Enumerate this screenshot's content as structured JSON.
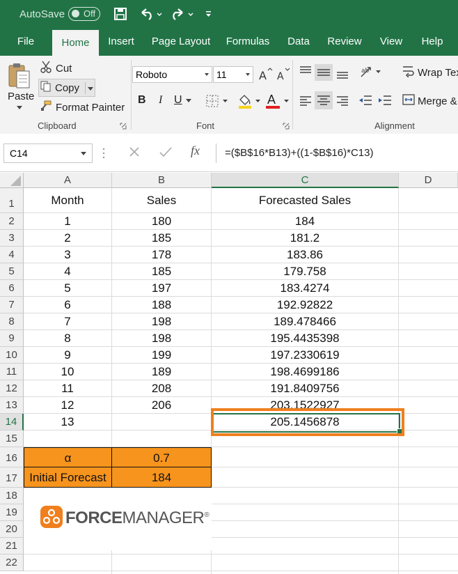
{
  "titlebar": {
    "autosave_label": "AutoSave",
    "autosave_state": "Off"
  },
  "tabs": [
    "File",
    "Home",
    "Insert",
    "Page Layout",
    "Formulas",
    "Data",
    "Review",
    "View",
    "Help"
  ],
  "clipboard": {
    "paste": "Paste",
    "cut": "Cut",
    "copy": "Copy",
    "format_painter": "Format Painter",
    "group_label": "Clipboard"
  },
  "font": {
    "family": "Roboto",
    "size": "11",
    "bold": "B",
    "italic": "I",
    "underline": "U",
    "color_letter": "A",
    "group_label": "Font"
  },
  "alignment": {
    "wrap_text": "Wrap Tex",
    "merge": "Merge &",
    "group_label": "Alignment"
  },
  "formula_bar": {
    "name_box": "C14",
    "formula": "=($B$16*B13)+((1-$B$16)*C13)",
    "fx": "fx"
  },
  "columns": [
    "A",
    "B",
    "C",
    "D"
  ],
  "rows": [
    "1",
    "2",
    "3",
    "4",
    "5",
    "6",
    "7",
    "8",
    "9",
    "10",
    "11",
    "12",
    "13",
    "14",
    "15",
    "16",
    "17",
    "18",
    "19",
    "20",
    "21",
    "22"
  ],
  "table": {
    "headers": [
      "Month",
      "Sales",
      "Forecasted Sales"
    ],
    "data": [
      [
        "1",
        "180",
        "184"
      ],
      [
        "2",
        "185",
        "181.2"
      ],
      [
        "3",
        "178",
        "183.86"
      ],
      [
        "4",
        "185",
        "179.758"
      ],
      [
        "5",
        "197",
        "183.4274"
      ],
      [
        "6",
        "188",
        "192.92822"
      ],
      [
        "7",
        "198",
        "189.478466"
      ],
      [
        "8",
        "198",
        "195.4435398"
      ],
      [
        "9",
        "199",
        "197.2330619"
      ],
      [
        "10",
        "189",
        "198.4699186"
      ],
      [
        "11",
        "208",
        "191.8409756"
      ],
      [
        "12",
        "206",
        "203.1522927"
      ],
      [
        "13",
        "",
        "205.1456878"
      ]
    ]
  },
  "params": {
    "alpha_label": "α",
    "alpha_value": "0.7",
    "initial_label": "Initial Forecast",
    "initial_value": "184"
  },
  "logo": {
    "part1": "FORCE",
    "part2": "MANAGER",
    "mark": "®"
  },
  "colors": {
    "excel_green": "#217346",
    "highlight_orange": "#f07f1d",
    "param_fill": "#f7941d"
  }
}
